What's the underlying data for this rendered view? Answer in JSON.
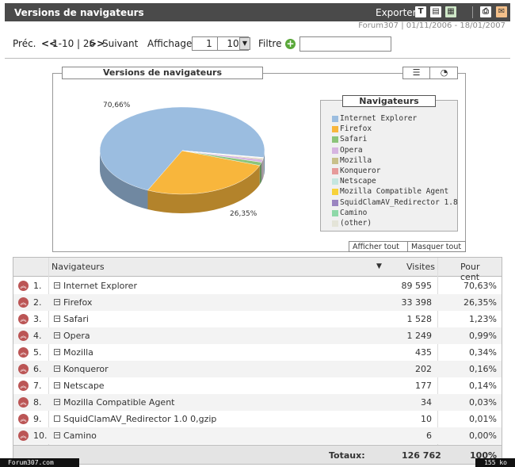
{
  "header": {
    "title": "Versions de navigateurs",
    "export_label": "Exporter",
    "subtitle": "Forum307 | 01/11/2006 - 18/01/2007"
  },
  "nav": {
    "prev_label": "Préc.",
    "prev_arrows": "<<",
    "range": "1-10 | 26",
    "next_arrows": ">>",
    "next_label": "Suivant",
    "display_label": "Affichage",
    "page_value": "1",
    "per_page_value": "10",
    "filter_label": "Filtre",
    "filter_value": ""
  },
  "chart": {
    "panel_title": "Versions de navigateurs",
    "legend_title": "Navigateurs",
    "show_all": "Afficher tout",
    "hide_all": "Masquer tout",
    "label_major": "70,66%",
    "label_minor": "26,35%"
  },
  "chart_data": {
    "type": "pie",
    "title": "Versions de navigateurs",
    "legend_placement": "right",
    "slices": [
      {
        "name": "Internet Explorer",
        "value": 70.63,
        "color": "#9bbde0"
      },
      {
        "name": "Firefox",
        "value": 26.35,
        "color": "#f8b63c"
      },
      {
        "name": "Safari",
        "value": 1.23,
        "color": "#8cc47a"
      },
      {
        "name": "Opera",
        "value": 0.99,
        "color": "#d6b4e0"
      },
      {
        "name": "Mozilla",
        "value": 0.34,
        "color": "#c8c08a"
      },
      {
        "name": "Konqueror",
        "value": 0.16,
        "color": "#e69a9a"
      },
      {
        "name": "Netscape",
        "value": 0.14,
        "color": "#c4e6e0"
      },
      {
        "name": "Mozilla Compatible Agent",
        "value": 0.03,
        "color": "#f7d23a"
      },
      {
        "name": "SquidClamAV_Redirector 1.8",
        "value": 0.01,
        "color": "#9a84c0"
      },
      {
        "name": "Camino",
        "value": 0.0,
        "color": "#8ed8a8"
      },
      {
        "name": "(other)",
        "value": 0.12,
        "color": "#e4e4d8"
      }
    ]
  },
  "table": {
    "col_browser": "Navigateurs",
    "col_visits": "Visites",
    "col_percent": "Pour cent",
    "rows": [
      {
        "rank": "1.",
        "name": "Internet Explorer",
        "visits": "89 595",
        "percent": "70,63%"
      },
      {
        "rank": "2.",
        "name": "Firefox",
        "visits": "33 398",
        "percent": "26,35%"
      },
      {
        "rank": "3.",
        "name": "Safari",
        "visits": "1 528",
        "percent": "1,23%"
      },
      {
        "rank": "4.",
        "name": "Opera",
        "visits": "1 249",
        "percent": "0,99%"
      },
      {
        "rank": "5.",
        "name": "Mozilla",
        "visits": "435",
        "percent": "0,34%"
      },
      {
        "rank": "6.",
        "name": "Konqueror",
        "visits": "202",
        "percent": "0,16%"
      },
      {
        "rank": "7.",
        "name": "Netscape",
        "visits": "177",
        "percent": "0,14%"
      },
      {
        "rank": "8.",
        "name": "Mozilla Compatible Agent",
        "visits": "34",
        "percent": "0,03%"
      },
      {
        "rank": "9.",
        "name": "SquidClamAV_Redirector 1.0 0,gzip",
        "visits": "10",
        "percent": "0,01%"
      },
      {
        "rank": "10.",
        "name": "Camino",
        "visits": "6",
        "percent": "0,00%"
      }
    ],
    "totals_label": "Totaux:",
    "totals_visits": "126 762",
    "totals_percent": "100%"
  },
  "footer": {
    "site": "Forum307.com",
    "size": "155 ko"
  },
  "icons": [
    "text-export-icon",
    "table-export-icon",
    "excel-export-icon",
    "print-icon",
    "email-icon"
  ]
}
